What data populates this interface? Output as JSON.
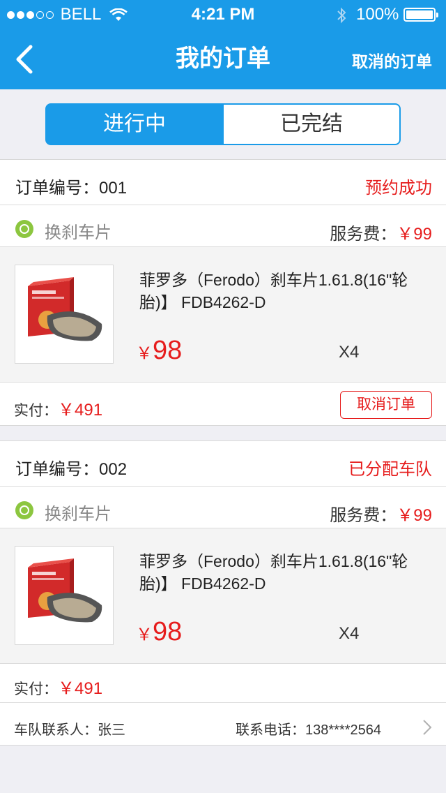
{
  "status_bar": {
    "carrier": "BELL",
    "time": "4:21 PM",
    "battery": "100%"
  },
  "nav": {
    "title": "我的订单",
    "right_action": "取消的订单"
  },
  "segments": {
    "active": "进行中",
    "inactive": "已完结"
  },
  "orders": [
    {
      "order_no_label": "订单编号：",
      "order_no": "001",
      "status": "预约成功",
      "service_name": "换刹车片",
      "fee_label": "服务费：",
      "fee": "￥99",
      "product_name": "菲罗多（Ferodo）刹车片1.61.8(16\"轮胎)】 FDB4262-D",
      "price_symbol": "￥",
      "price": "98",
      "qty": "X4",
      "paid_label": "实付：",
      "paid": "￥491",
      "cancel_label": "取消订单"
    },
    {
      "order_no_label": "订单编号：",
      "order_no": "002",
      "status": "已分配车队",
      "service_name": "换刹车片",
      "fee_label": "服务费：",
      "fee": "￥99",
      "product_name": "菲罗多（Ferodo）刹车片1.61.8(16\"轮胎)】 FDB4262-D",
      "price_symbol": "￥",
      "price": "98",
      "qty": "X4",
      "paid_label": "实付：",
      "paid": "￥491",
      "contact_label": "车队联系人：",
      "contact_name": "张三",
      "phone_label": "联系电话：",
      "phone": "138****2564"
    }
  ],
  "colors": {
    "brand": "#1a9be8",
    "accent_red": "#e61c1c",
    "wheel_icon": "#8cc63f"
  }
}
